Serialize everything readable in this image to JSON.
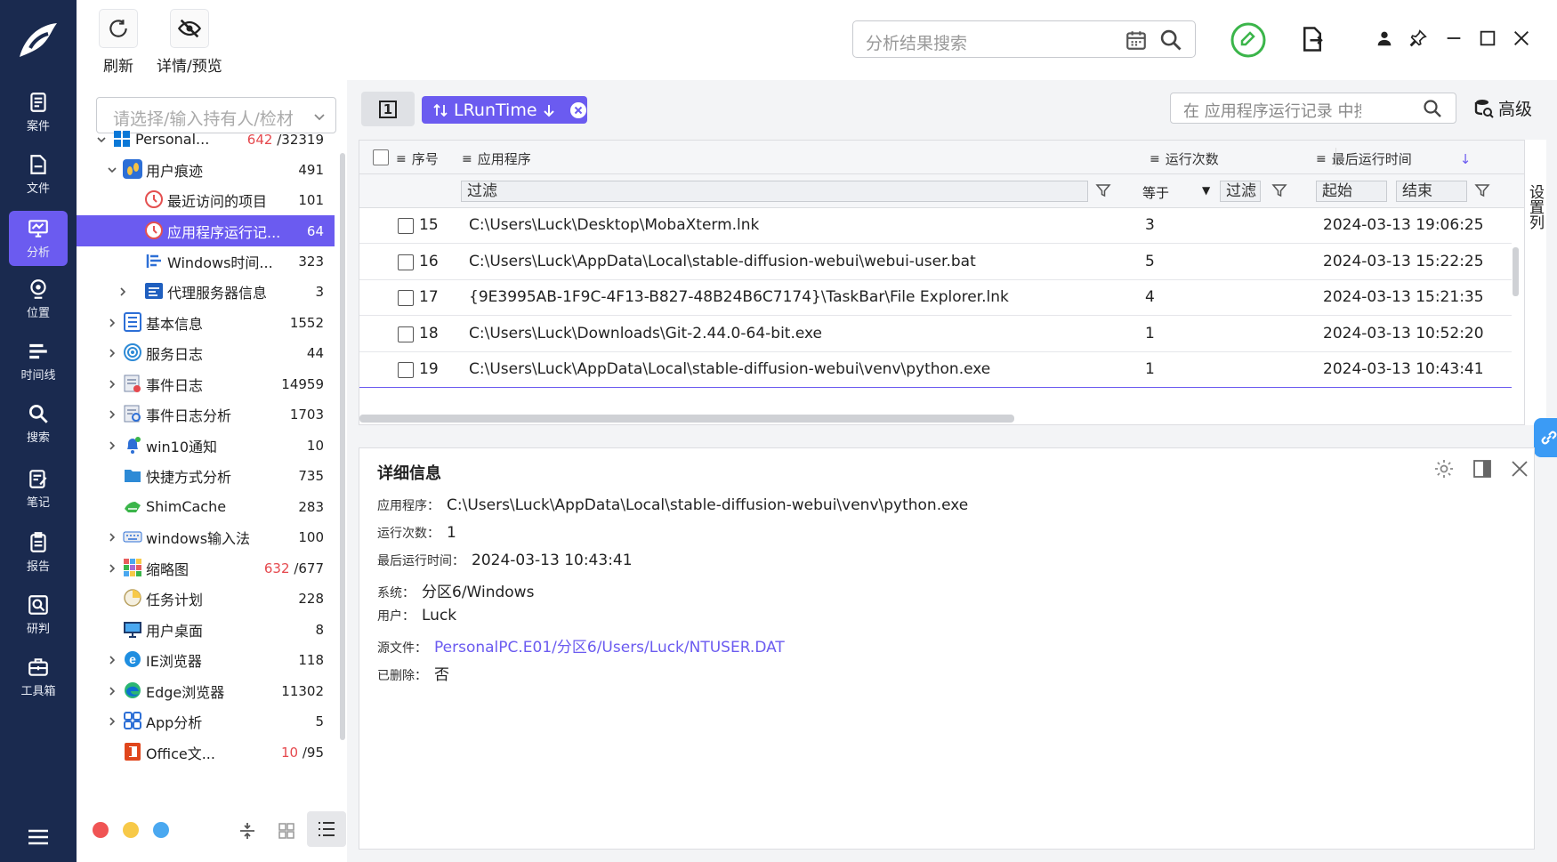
{
  "nav": {
    "items": [
      {
        "label": "案件",
        "icon": "case-icon"
      },
      {
        "label": "文件",
        "icon": "file-icon"
      },
      {
        "label": "分析",
        "icon": "analysis-icon"
      },
      {
        "label": "位置",
        "icon": "location-icon"
      },
      {
        "label": "时间线",
        "icon": "timeline-icon"
      },
      {
        "label": "搜索",
        "icon": "search-icon"
      },
      {
        "label": "笔记",
        "icon": "note-icon"
      },
      {
        "label": "报告",
        "icon": "report-icon"
      },
      {
        "label": "研判",
        "icon": "judge-icon"
      },
      {
        "label": "工具箱",
        "icon": "toolbox-icon"
      }
    ],
    "active_index": 2
  },
  "toolbar": {
    "refresh_label": "刷新",
    "preview_label": "详情/预览"
  },
  "top_search": {
    "placeholder": "分析结果搜索"
  },
  "side": {
    "select_placeholder": "请选择/输入持有人/检材",
    "tree": [
      {
        "label": "Personal...",
        "count_red": "642",
        "count": "/32319"
      },
      {
        "label": "用户痕迹",
        "count": "491"
      },
      {
        "label": "最近访问的项目",
        "count": "101"
      },
      {
        "label": "应用程序运行记...",
        "count": "64"
      },
      {
        "label": "Windows时间...",
        "count": "323"
      },
      {
        "label": "代理服务器信息",
        "count": "3"
      },
      {
        "label": "基本信息",
        "count": "1552"
      },
      {
        "label": "服务日志",
        "count": "44"
      },
      {
        "label": "事件日志",
        "count": "14959"
      },
      {
        "label": "事件日志分析",
        "count": "1703"
      },
      {
        "label": "win10通知",
        "count": "10"
      },
      {
        "label": "快捷方式分析",
        "count": "735"
      },
      {
        "label": "ShimCache",
        "count": "283"
      },
      {
        "label": "windows输入法",
        "count": "100"
      },
      {
        "label": "缩略图",
        "count_red": "632",
        "count": "/677"
      },
      {
        "label": "任务计划",
        "count": "228"
      },
      {
        "label": "用户桌面",
        "count": "8"
      },
      {
        "label": "IE浏览器",
        "count": "118"
      },
      {
        "label": "Edge浏览器",
        "count": "11302"
      },
      {
        "label": "App分析",
        "count": "5"
      },
      {
        "label": "Office文...",
        "count_red": "10",
        "count": "/95"
      }
    ]
  },
  "grid": {
    "page_button": "1",
    "sort_chip": "LRunTime",
    "search_placeholder": "在 应用程序运行记录 中搜索",
    "advanced_label": "高级",
    "columns": [
      "序号",
      "应用程序",
      "运行次数",
      "最后运行时间"
    ],
    "filter_placeholder": "过滤",
    "filter_op": "等于",
    "filter_start": "起始",
    "filter_end": "结束",
    "settings_label": "设置列",
    "rows": [
      {
        "no": "15",
        "app": "C:\\Users\\Luck\\Desktop\\MobaXterm.lnk",
        "count": "3",
        "time": "2024-03-13 19:06:25"
      },
      {
        "no": "16",
        "app": "C:\\Users\\Luck\\AppData\\Local\\stable-diffusion-webui\\webui-user.bat",
        "count": "5",
        "time": "2024-03-13 15:22:25"
      },
      {
        "no": "17",
        "app": "{9E3995AB-1F9C-4F13-B827-48B24B6C7174}\\TaskBar\\File Explorer.lnk",
        "count": "4",
        "time": "2024-03-13 15:21:35"
      },
      {
        "no": "18",
        "app": "C:\\Users\\Luck\\Downloads\\Git-2.44.0-64-bit.exe",
        "count": "1",
        "time": "2024-03-13 10:52:20"
      },
      {
        "no": "19",
        "app": "C:\\Users\\Luck\\AppData\\Local\\stable-diffusion-webui\\venv\\python.exe",
        "count": "1",
        "time": "2024-03-13 10:43:41"
      }
    ]
  },
  "detail": {
    "title": "详细信息",
    "fields": [
      {
        "k": "应用程序：",
        "v": "C:\\Users\\Luck\\AppData\\Local\\stable-diffusion-webui\\venv\\python.exe"
      },
      {
        "k": "运行次数：",
        "v": "1"
      },
      {
        "k": "最后运行时间：",
        "v": "2024-03-13 10:43:41"
      },
      {
        "k": "系统：",
        "v": "分区6/Windows"
      },
      {
        "k": "用户：",
        "v": "Luck"
      },
      {
        "k": "源文件：",
        "v": "PersonalPC.E01/分区6/Users/Luck/NTUSER.DAT"
      },
      {
        "k": "已删除：",
        "v": "否"
      }
    ]
  },
  "colors": {
    "accent": "#6b5bf0",
    "nav_bg": "#1a2a4f",
    "count_red": "#e5484d"
  }
}
